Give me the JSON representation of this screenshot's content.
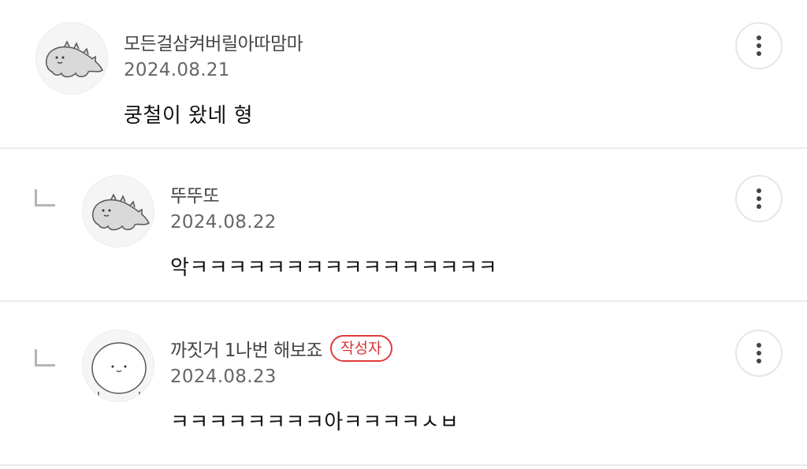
{
  "comments": [
    {
      "nickname": "모든걸삼켜버릴아따맘마",
      "date": "2024.08.21",
      "text": "쿵철이 왔네 형",
      "is_reply": false,
      "avatar_icon": "dinosaur-avatar-icon"
    },
    {
      "nickname": "뚜뚜또",
      "date": "2024.08.22",
      "text": "악ㅋㅋㅋㅋㅋㅋㅋㅋㅋㅋㅋㅋㅋㅋㅋㅋ",
      "is_reply": true,
      "avatar_icon": "dinosaur-avatar-icon"
    },
    {
      "nickname": "까짓거 1나번 해보죠",
      "badge": "작성자",
      "date": "2024.08.23",
      "text": "ㅋㅋㅋㅋㅋㅋㅋㅋ아ㅋㅋㅋㅋㅅㅂ",
      "is_reply": true,
      "avatar_icon": "round-face-avatar-icon"
    }
  ],
  "more_button_icon": "more-vertical-icon",
  "colors": {
    "badge_red": "#d83333",
    "divider": "#ebebeb"
  }
}
